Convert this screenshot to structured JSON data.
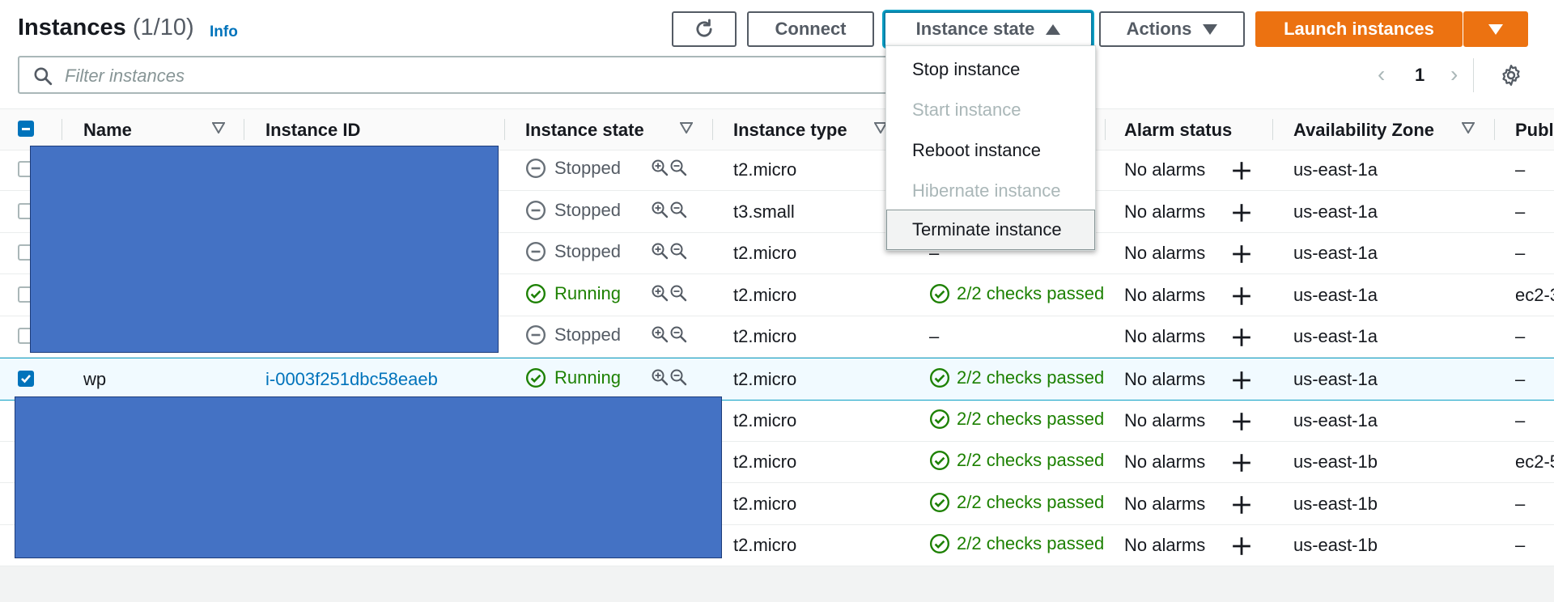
{
  "header": {
    "title": "Instances",
    "count": "(1/10)",
    "info_link": "Info"
  },
  "toolbar": {
    "connect_label": "Connect",
    "instance_state_label": "Instance state",
    "actions_label": "Actions",
    "launch_label": "Launch instances"
  },
  "search": {
    "placeholder": "Filter instances",
    "value": ""
  },
  "pagination": {
    "current_page": "1"
  },
  "instance_state_menu": {
    "stop": "Stop instance",
    "start": "Start instance",
    "reboot": "Reboot instance",
    "hibernate": "Hibernate instance",
    "terminate": "Terminate instance"
  },
  "table": {
    "columns": {
      "name": "Name",
      "instance_id": "Instance ID",
      "instance_state": "Instance state",
      "instance_type": "Instance type",
      "alarm_status": "Alarm status",
      "availability_zone": "Availability Zone",
      "public": "Publ"
    },
    "rows": [
      {
        "name": "",
        "id": "",
        "state": "Stopped",
        "type": "t2.micro",
        "status": "",
        "alarm": "No alarms",
        "az": "us-east-1a",
        "public": "–"
      },
      {
        "name": "",
        "id": "",
        "state": "Stopped",
        "type": "t3.small",
        "status": "",
        "alarm": "No alarms",
        "az": "us-east-1a",
        "public": "–"
      },
      {
        "name": "",
        "id": "",
        "state": "Stopped",
        "type": "t2.micro",
        "status": "–",
        "alarm": "No alarms",
        "az": "us-east-1a",
        "public": "–"
      },
      {
        "name": "",
        "id": "",
        "state": "Running",
        "type": "t2.micro",
        "status": "2/2 checks passed",
        "alarm": "No alarms",
        "az": "us-east-1a",
        "public": "ec2-3"
      },
      {
        "name": "",
        "id": "",
        "state": "Stopped",
        "type": "t2.micro",
        "status": "–",
        "alarm": "No alarms",
        "az": "us-east-1a",
        "public": "–"
      },
      {
        "name": "wp",
        "id": "i-0003f251dbc58eaeb",
        "state": "Running",
        "type": "t2.micro",
        "status": "2/2 checks passed",
        "alarm": "No alarms",
        "az": "us-east-1a",
        "public": "–"
      },
      {
        "name": "",
        "id": "",
        "state": "",
        "type": "t2.micro",
        "status": "2/2 checks passed",
        "alarm": "No alarms",
        "az": "us-east-1a",
        "public": "–"
      },
      {
        "name": "",
        "id": "",
        "state": "",
        "type": "t2.micro",
        "status": "2/2 checks passed",
        "alarm": "No alarms",
        "az": "us-east-1b",
        "public": "ec2-5"
      },
      {
        "name": "",
        "id": "",
        "state": "",
        "type": "t2.micro",
        "status": "2/2 checks passed",
        "alarm": "No alarms",
        "az": "us-east-1b",
        "public": "–"
      },
      {
        "name": "",
        "id": "",
        "state": "",
        "type": "t2.micro",
        "status": "2/2 checks passed",
        "alarm": "No alarms",
        "az": "us-east-1b",
        "public": "–"
      }
    ]
  },
  "colors": {
    "accent_orange": "#ec7211",
    "link_blue": "#0073bb",
    "running_green": "#1d8102",
    "redaction_blue": "#4472c4"
  }
}
